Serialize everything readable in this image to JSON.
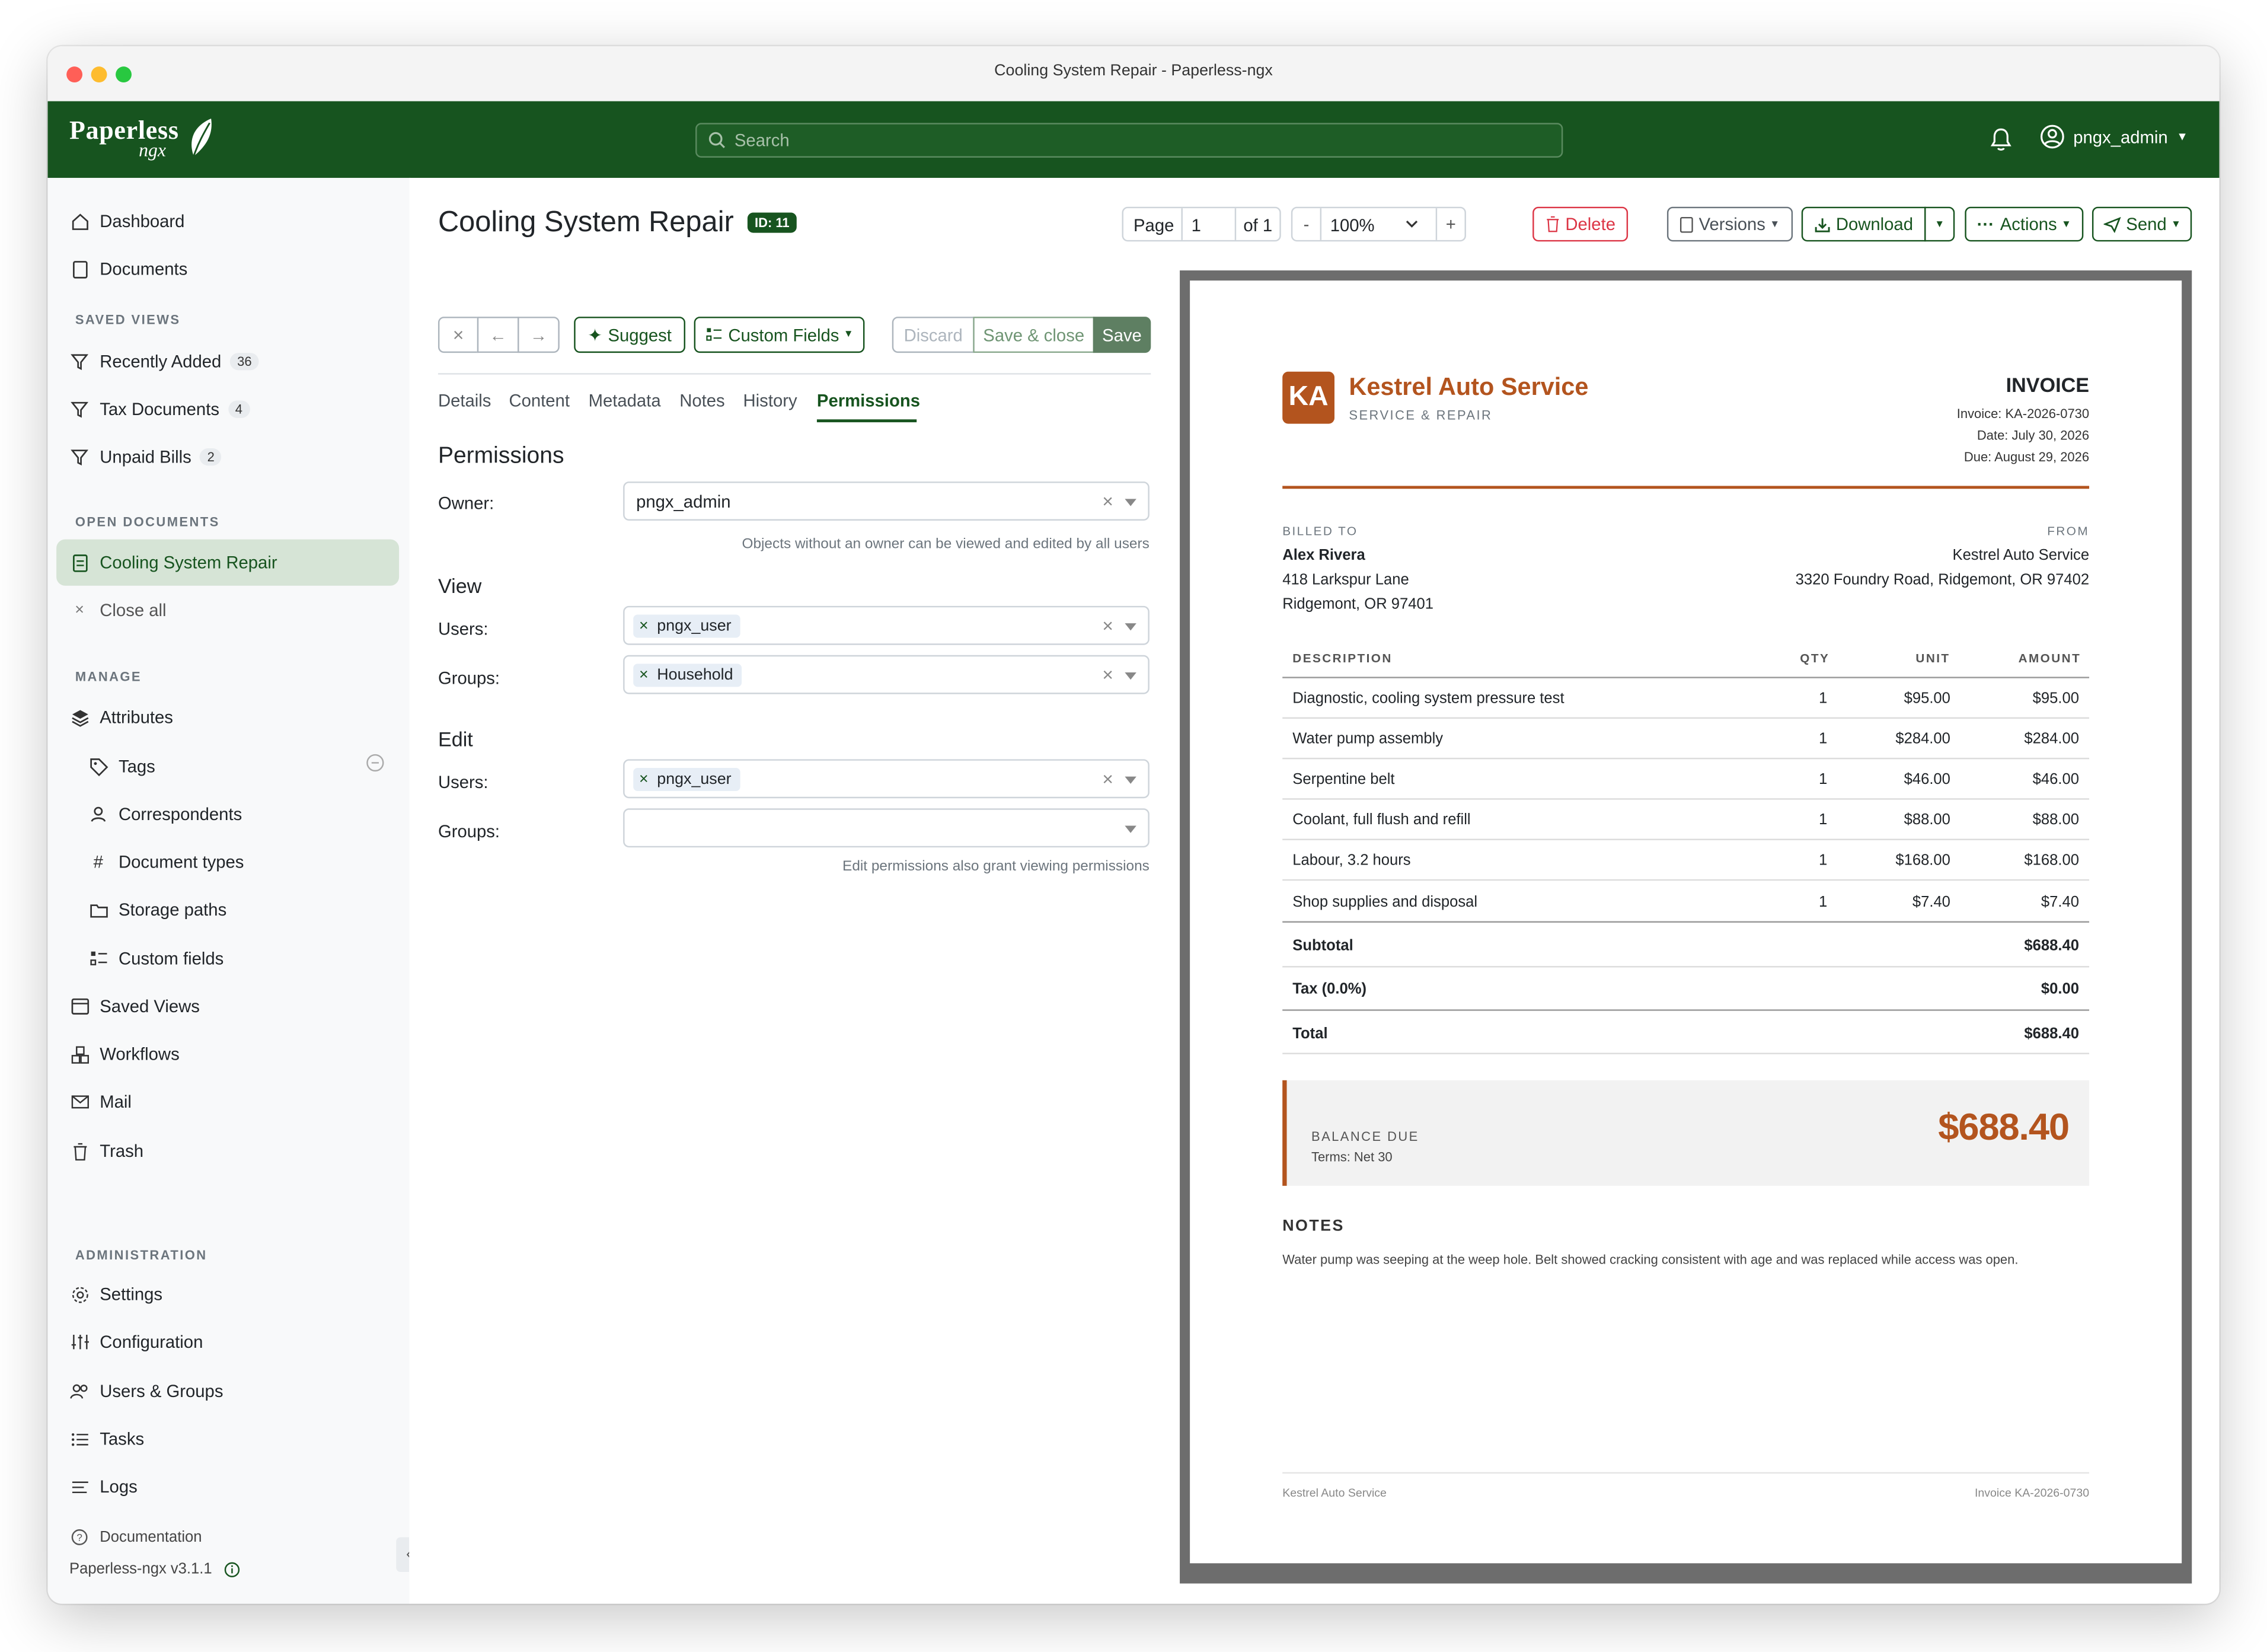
{
  "window": {
    "title": "Cooling System Repair - Paperless-ngx"
  },
  "app": {
    "logo_main": "Paperless",
    "logo_sub": "ngx",
    "search_placeholder": "Search",
    "username": "pngx_admin"
  },
  "sidebar": {
    "dashboard": "Dashboard",
    "documents": "Documents",
    "saved_views_head": "SAVED VIEWS",
    "saved_views": [
      {
        "label": "Recently Added",
        "count": "36"
      },
      {
        "label": "Tax Documents",
        "count": "4"
      },
      {
        "label": "Unpaid Bills",
        "count": "2"
      }
    ],
    "open_docs_head": "OPEN DOCUMENTS",
    "open_doc": "Cooling System Repair",
    "close_all": "Close all",
    "manage_head": "MANAGE",
    "attributes": "Attributes",
    "tags": "Tags",
    "correspondents": "Correspondents",
    "document_types": "Document types",
    "storage_paths": "Storage paths",
    "custom_fields": "Custom fields",
    "saved_views_link": "Saved Views",
    "workflows": "Workflows",
    "mail": "Mail",
    "trash": "Trash",
    "admin_head": "ADMINISTRATION",
    "settings": "Settings",
    "configuration": "Configuration",
    "users_groups": "Users & Groups",
    "tasks": "Tasks",
    "logs": "Logs",
    "documentation": "Documentation",
    "version": "Paperless-ngx v3.1.1"
  },
  "doc": {
    "title": "Cooling System Repair",
    "id_badge": "ID: 11"
  },
  "pager": {
    "page_label": "Page",
    "page_value": "1",
    "of_label": "of 1",
    "minus": "-",
    "zoom": "100%",
    "plus": "+"
  },
  "toolbar": {
    "delete": "Delete",
    "versions": "Versions",
    "download": "Download",
    "actions": "Actions",
    "send": "Send",
    "suggest": "Suggest",
    "custom_fields": "Custom Fields",
    "discard": "Discard",
    "save_close": "Save & close",
    "save": "Save"
  },
  "tabs": [
    "Details",
    "Content",
    "Metadata",
    "Notes",
    "History",
    "Permissions"
  ],
  "permissions": {
    "title": "Permissions",
    "owner_label": "Owner:",
    "owner_value": "pngx_admin",
    "owner_hint": "Objects without an owner can be viewed and edited by all users",
    "view_title": "View",
    "users_label": "Users:",
    "groups_label": "Groups:",
    "view_users": "pngx_user",
    "view_groups": "Household",
    "edit_title": "Edit",
    "edit_users": "pngx_user",
    "edit_hint": "Edit permissions also grant viewing permissions"
  },
  "invoice": {
    "logo_initials": "KA",
    "company": "Kestrel Auto Service",
    "company_sub": "SERVICE & REPAIR",
    "title": "INVOICE",
    "number": "Invoice: KA-2026-0730",
    "date": "Date: July 30, 2026",
    "due": "Due: August 29, 2026",
    "billed_to_head": "BILLED TO",
    "billed_name": "Alex Rivera",
    "billed_addr1": "418 Larkspur Lane",
    "billed_addr2": "Ridgemont, OR 97401",
    "from_head": "FROM",
    "from_name": "Kestrel Auto Service",
    "from_addr": "3320 Foundry Road, Ridgemont, OR 97402",
    "columns": [
      "DESCRIPTION",
      "QTY",
      "UNIT",
      "AMOUNT"
    ],
    "items": [
      {
        "desc": "Diagnostic, cooling system pressure test",
        "qty": "1",
        "unit": "$95.00",
        "amount": "$95.00"
      },
      {
        "desc": "Water pump assembly",
        "qty": "1",
        "unit": "$284.00",
        "amount": "$284.00"
      },
      {
        "desc": "Serpentine belt",
        "qty": "1",
        "unit": "$46.00",
        "amount": "$46.00"
      },
      {
        "desc": "Coolant, full flush and refill",
        "qty": "1",
        "unit": "$88.00",
        "amount": "$88.00"
      },
      {
        "desc": "Labour, 3.2 hours",
        "qty": "1",
        "unit": "$168.00",
        "amount": "$168.00"
      },
      {
        "desc": "Shop supplies and disposal",
        "qty": "1",
        "unit": "$7.40",
        "amount": "$7.40"
      }
    ],
    "subtotal_label": "Subtotal",
    "subtotal": "$688.40",
    "tax_label": "Tax (0.0%)",
    "tax": "$0.00",
    "total_label": "Total",
    "total": "$688.40",
    "balance_label": "BALANCE DUE",
    "terms": "Terms: Net 30",
    "balance": "$688.40",
    "notes_head": "NOTES",
    "notes": "Water pump was seeping at the weep hole. Belt showed cracking consistent with age and was replaced while access was open.",
    "footer_left": "Kestrel Auto Service",
    "footer_right": "Invoice KA-2026-0730"
  },
  "colors": {
    "brand": "#17541f",
    "accent_invoice": "#b3541e",
    "danger": "#dc3545"
  }
}
